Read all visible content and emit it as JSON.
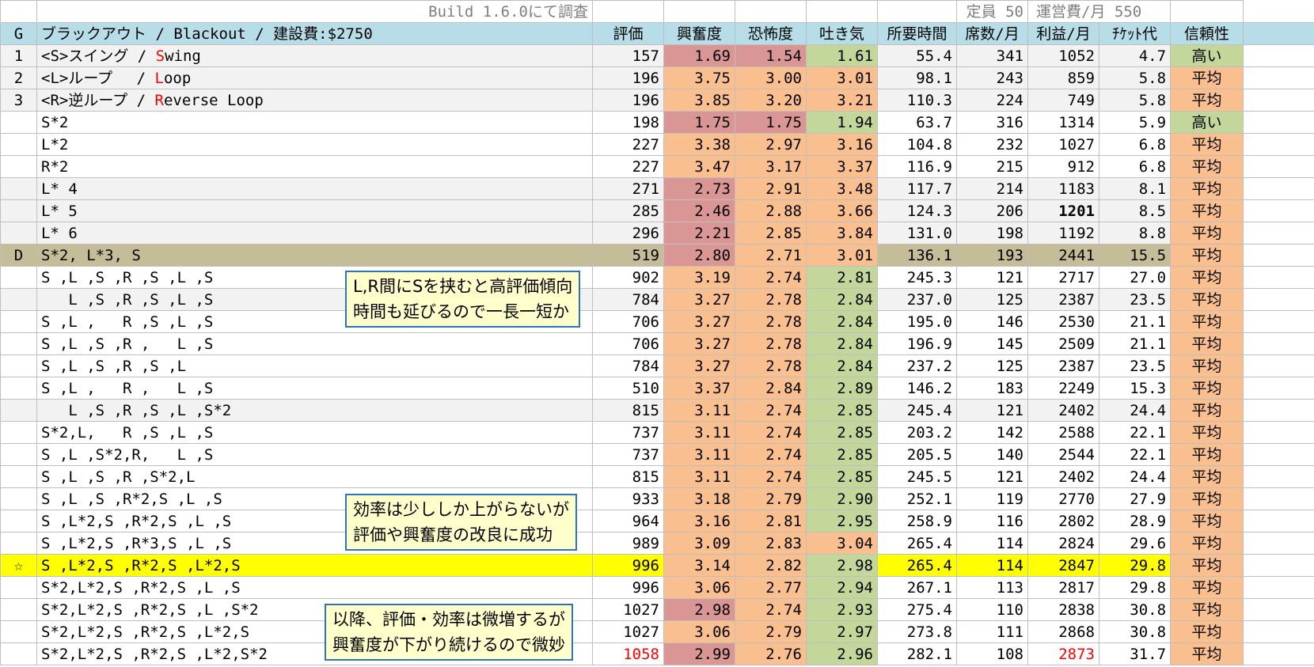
{
  "title": {
    "build": "Build 1.6.0にて調査",
    "capacity": "定員 50",
    "cost": "運営費/月 550"
  },
  "headers": {
    "g": "G",
    "name": "ブラックアウト / Blackout / 建設費:$2750",
    "rating": "評価",
    "excitement": "興奮度",
    "intensity": "恐怖度",
    "nausea": "吐き気",
    "duration": "所要時間",
    "seats": "席数/月",
    "profit": "利益/月",
    "ticket": "ﾁｹｯﾄ代",
    "reliability": "信頼性"
  },
  "rows": [
    {
      "g": "1",
      "name": "<S>スイング / Swing",
      "rating": "157",
      "excitement": "1.69",
      "intensity": "1.54",
      "nausea": "1.61",
      "duration": "55.4",
      "seats": "341",
      "profit": "1052",
      "ticket": "4.7",
      "reliability": "高い",
      "exc_color": "red",
      "int_color": "red",
      "nau_color": "green",
      "rel_color": "green",
      "row_bg": "gray"
    },
    {
      "g": "2",
      "name": "<L>ループ　 / Loop",
      "rating": "196",
      "excitement": "3.75",
      "intensity": "3.00",
      "nausea": "3.01",
      "duration": "98.1",
      "seats": "243",
      "profit": "859",
      "ticket": "5.8",
      "reliability": "平均",
      "exc_color": "orange",
      "int_color": "orange",
      "nau_color": "orange",
      "rel_color": "orange",
      "row_bg": "gray"
    },
    {
      "g": "3",
      "name": "<R>逆ループ / Reverse Loop",
      "rating": "196",
      "excitement": "3.85",
      "intensity": "3.20",
      "nausea": "3.21",
      "duration": "110.3",
      "seats": "224",
      "profit": "749",
      "ticket": "5.8",
      "reliability": "平均",
      "exc_color": "orange",
      "int_color": "orange",
      "nau_color": "orange",
      "rel_color": "orange",
      "row_bg": "gray"
    },
    {
      "g": "",
      "name": "S*2",
      "rating": "198",
      "excitement": "1.75",
      "intensity": "1.75",
      "nausea": "1.94",
      "duration": "63.7",
      "seats": "316",
      "profit": "1314",
      "ticket": "5.9",
      "reliability": "高い",
      "exc_color": "red",
      "int_color": "red",
      "nau_color": "green",
      "rel_color": "green",
      "row_bg": "white"
    },
    {
      "g": "",
      "name": "L*2",
      "rating": "227",
      "excitement": "3.38",
      "intensity": "2.97",
      "nausea": "3.16",
      "duration": "104.8",
      "seats": "232",
      "profit": "1027",
      "ticket": "6.8",
      "reliability": "平均",
      "exc_color": "orange",
      "int_color": "orange",
      "nau_color": "orange",
      "rel_color": "orange",
      "row_bg": "white"
    },
    {
      "g": "",
      "name": "R*2",
      "rating": "227",
      "excitement": "3.47",
      "intensity": "3.17",
      "nausea": "3.37",
      "duration": "116.9",
      "seats": "215",
      "profit": "912",
      "ticket": "6.8",
      "reliability": "平均",
      "exc_color": "orange",
      "int_color": "orange",
      "nau_color": "orange",
      "rel_color": "orange",
      "row_bg": "white"
    },
    {
      "g": "",
      "name": "L* 4",
      "rating": "271",
      "excitement": "2.73",
      "intensity": "2.91",
      "nausea": "3.48",
      "duration": "117.7",
      "seats": "214",
      "profit": "1183",
      "ticket": "8.1",
      "reliability": "平均",
      "exc_color": "red",
      "int_color": "orange",
      "nau_color": "orange",
      "rel_color": "orange",
      "row_bg": "gray"
    },
    {
      "g": "",
      "name": "L* 5",
      "rating": "285",
      "excitement": "2.46",
      "intensity": "2.88",
      "nausea": "3.66",
      "duration": "124.3",
      "seats": "206",
      "profit": "1201",
      "ticket": "8.5",
      "reliability": "平均",
      "exc_color": "red",
      "int_color": "orange",
      "nau_color": "orange",
      "rel_color": "orange",
      "row_bg": "gray",
      "profit_style": "bold"
    },
    {
      "g": "",
      "name": "L* 6",
      "rating": "296",
      "excitement": "2.21",
      "intensity": "2.85",
      "nausea": "3.84",
      "duration": "131.0",
      "seats": "198",
      "profit": "1192",
      "ticket": "8.8",
      "reliability": "平均",
      "exc_color": "red",
      "int_color": "orange",
      "nau_color": "orange",
      "rel_color": "orange",
      "row_bg": "gray"
    },
    {
      "g": "D",
      "name": "S*2, L*3, S",
      "rating": "519",
      "excitement": "2.80",
      "intensity": "2.71",
      "nausea": "3.01",
      "duration": "136.1",
      "seats": "193",
      "profit": "2441",
      "ticket": "15.5",
      "reliability": "平均",
      "exc_color": "red",
      "int_color": "orange",
      "nau_color": "orange",
      "rel_color": "orange",
      "row_bg": "dark"
    },
    {
      "g": "",
      "name": "S ,L ,S ,R ,S ,L ,S",
      "rating": "902",
      "excitement": "3.19",
      "intensity": "2.74",
      "nausea": "2.81",
      "duration": "245.3",
      "seats": "121",
      "profit": "2717",
      "ticket": "27.0",
      "reliability": "平均",
      "exc_color": "orange",
      "int_color": "orange",
      "nau_color": "green",
      "rel_color": "orange",
      "row_bg": "white"
    },
    {
      "g": "",
      "name": "   L ,S ,R ,S ,L ,S",
      "rating": "784",
      "excitement": "3.27",
      "intensity": "2.78",
      "nausea": "2.84",
      "duration": "237.0",
      "seats": "125",
      "profit": "2387",
      "ticket": "23.5",
      "reliability": "平均",
      "exc_color": "orange",
      "int_color": "orange",
      "nau_color": "green",
      "rel_color": "orange",
      "row_bg": "gray"
    },
    {
      "g": "",
      "name": "S ,L ,   R ,S ,L ,S",
      "rating": "706",
      "excitement": "3.27",
      "intensity": "2.78",
      "nausea": "2.84",
      "duration": "195.0",
      "seats": "146",
      "profit": "2530",
      "ticket": "21.1",
      "reliability": "平均",
      "exc_color": "orange",
      "int_color": "orange",
      "nau_color": "green",
      "rel_color": "orange",
      "row_bg": "white"
    },
    {
      "g": "",
      "name": "S ,L ,S ,R ,   L ,S",
      "rating": "706",
      "excitement": "3.27",
      "intensity": "2.78",
      "nausea": "2.84",
      "duration": "196.9",
      "seats": "145",
      "profit": "2509",
      "ticket": "21.1",
      "reliability": "平均",
      "exc_color": "orange",
      "int_color": "orange",
      "nau_color": "green",
      "rel_color": "orange",
      "row_bg": "white"
    },
    {
      "g": "",
      "name": "S ,L ,S ,R ,S ,L",
      "rating": "784",
      "excitement": "3.27",
      "intensity": "2.78",
      "nausea": "2.84",
      "duration": "237.2",
      "seats": "125",
      "profit": "2387",
      "ticket": "23.5",
      "reliability": "平均",
      "exc_color": "orange",
      "int_color": "orange",
      "nau_color": "green",
      "rel_color": "orange",
      "row_bg": "white"
    },
    {
      "g": "",
      "name": "S ,L ,   R ,   L ,S",
      "rating": "510",
      "excitement": "3.37",
      "intensity": "2.84",
      "nausea": "2.89",
      "duration": "146.2",
      "seats": "183",
      "profit": "2249",
      "ticket": "15.3",
      "reliability": "平均",
      "exc_color": "orange",
      "int_color": "orange",
      "nau_color": "green",
      "rel_color": "orange",
      "row_bg": "white"
    },
    {
      "g": "",
      "name": "   L ,S ,R ,S ,L ,S*2",
      "rating": "815",
      "excitement": "3.11",
      "intensity": "2.74",
      "nausea": "2.85",
      "duration": "245.4",
      "seats": "121",
      "profit": "2402",
      "ticket": "24.4",
      "reliability": "平均",
      "exc_color": "orange",
      "int_color": "orange",
      "nau_color": "green",
      "rel_color": "orange",
      "row_bg": "gray"
    },
    {
      "g": "",
      "name": "S*2,L,   R ,S ,L ,S",
      "rating": "737",
      "excitement": "3.11",
      "intensity": "2.74",
      "nausea": "2.85",
      "duration": "203.2",
      "seats": "142",
      "profit": "2588",
      "ticket": "22.1",
      "reliability": "平均",
      "exc_color": "orange",
      "int_color": "orange",
      "nau_color": "green",
      "rel_color": "orange",
      "row_bg": "white"
    },
    {
      "g": "",
      "name": "S ,L ,S*2,R,   L ,S",
      "rating": "737",
      "excitement": "3.11",
      "intensity": "2.74",
      "nausea": "2.85",
      "duration": "205.5",
      "seats": "140",
      "profit": "2544",
      "ticket": "22.1",
      "reliability": "平均",
      "exc_color": "orange",
      "int_color": "orange",
      "nau_color": "green",
      "rel_color": "orange",
      "row_bg": "white"
    },
    {
      "g": "",
      "name": "S ,L ,S ,R ,S*2,L",
      "rating": "815",
      "excitement": "3.11",
      "intensity": "2.74",
      "nausea": "2.85",
      "duration": "245.5",
      "seats": "121",
      "profit": "2402",
      "ticket": "24.4",
      "reliability": "平均",
      "exc_color": "orange",
      "int_color": "orange",
      "nau_color": "green",
      "rel_color": "orange",
      "row_bg": "white"
    },
    {
      "g": "",
      "name": "S ,L ,S ,R*2,S ,L ,S",
      "rating": "933",
      "excitement": "3.18",
      "intensity": "2.79",
      "nausea": "2.90",
      "duration": "252.1",
      "seats": "119",
      "profit": "2770",
      "ticket": "27.9",
      "reliability": "平均",
      "exc_color": "orange",
      "int_color": "orange",
      "nau_color": "green",
      "rel_color": "orange",
      "row_bg": "white"
    },
    {
      "g": "",
      "name": "S ,L*2,S ,R*2,S ,L ,S",
      "rating": "964",
      "excitement": "3.16",
      "intensity": "2.81",
      "nausea": "2.95",
      "duration": "258.9",
      "seats": "116",
      "profit": "2802",
      "ticket": "28.9",
      "reliability": "平均",
      "exc_color": "orange",
      "int_color": "orange",
      "nau_color": "green",
      "rel_color": "orange",
      "row_bg": "white"
    },
    {
      "g": "",
      "name": "S ,L*2,S ,R*3,S ,L ,S",
      "rating": "989",
      "excitement": "3.09",
      "intensity": "2.83",
      "nausea": "3.04",
      "duration": "265.4",
      "seats": "114",
      "profit": "2824",
      "ticket": "29.6",
      "reliability": "平均",
      "exc_color": "orange",
      "int_color": "orange",
      "nau_color": "orange",
      "rel_color": "orange",
      "row_bg": "white"
    },
    {
      "g": "☆",
      "name": "S ,L*2,S ,R*2,S ,L*2,S",
      "rating": "996",
      "excitement": "3.14",
      "intensity": "2.82",
      "nausea": "2.98",
      "duration": "265.4",
      "seats": "114",
      "profit": "2847",
      "ticket": "29.8",
      "reliability": "平均",
      "exc_color": "orange",
      "int_color": "orange",
      "nau_color": "green",
      "rel_color": "orange",
      "row_bg": "star"
    },
    {
      "g": "",
      "name": "S*2,L*2,S ,R*2,S ,L ,S",
      "rating": "996",
      "excitement": "3.06",
      "intensity": "2.77",
      "nausea": "2.94",
      "duration": "267.1",
      "seats": "113",
      "profit": "2817",
      "ticket": "29.8",
      "reliability": "平均",
      "exc_color": "orange",
      "int_color": "orange",
      "nau_color": "green",
      "rel_color": "orange",
      "row_bg": "white"
    },
    {
      "g": "",
      "name": "S*2,L*2,S ,R*2,S ,L ,S*2",
      "rating": "1027",
      "excitement": "2.98",
      "intensity": "2.74",
      "nausea": "2.93",
      "duration": "275.4",
      "seats": "110",
      "profit": "2838",
      "ticket": "30.8",
      "reliability": "平均",
      "exc_color": "red",
      "int_color": "orange",
      "nau_color": "green",
      "rel_color": "orange",
      "row_bg": "white"
    },
    {
      "g": "",
      "name": "S*2,L*2,S ,R*2,S ,L*2,S",
      "rating": "1027",
      "excitement": "3.06",
      "intensity": "2.79",
      "nausea": "2.97",
      "duration": "273.8",
      "seats": "111",
      "profit": "2868",
      "ticket": "30.8",
      "reliability": "平均",
      "exc_color": "orange",
      "int_color": "orange",
      "nau_color": "green",
      "rel_color": "orange",
      "row_bg": "white"
    },
    {
      "g": "",
      "name": "S*2,L*2,S ,R*2,S ,L*2,S*2",
      "rating": "1058",
      "excitement": "2.99",
      "intensity": "2.76",
      "nausea": "2.96",
      "duration": "282.1",
      "seats": "108",
      "profit": "2873",
      "ticket": "31.7",
      "reliability": "平均",
      "exc_color": "red",
      "int_color": "orange",
      "nau_color": "green",
      "rel_color": "orange",
      "row_bg": "white",
      "rating_style": "red",
      "profit_style": "red"
    }
  ],
  "notes": [
    {
      "lines": [
        "L,R間にSを挟むと高評価傾向",
        "時間も延びるので一長一短か"
      ]
    },
    {
      "lines": [
        "効率は少ししか上がらないが",
        "評価や興奮度の改良に成功"
      ]
    },
    {
      "lines": [
        "以降、評価・効率は微増するが",
        "興奮度が下がり続けるので微妙"
      ]
    }
  ],
  "colors": {
    "header_bg": "#b7dee8",
    "red_cell": "#da9694",
    "orange_cell": "#fabf8f",
    "green_cell": "#c4d79b",
    "highlight_row": "#ffff00",
    "d_row": "#c4bd97",
    "gray_row": "#f2f2f2",
    "note_bg": "#ffffcc",
    "note_border": "#2e75b6",
    "accent_text": "#ff0000"
  }
}
